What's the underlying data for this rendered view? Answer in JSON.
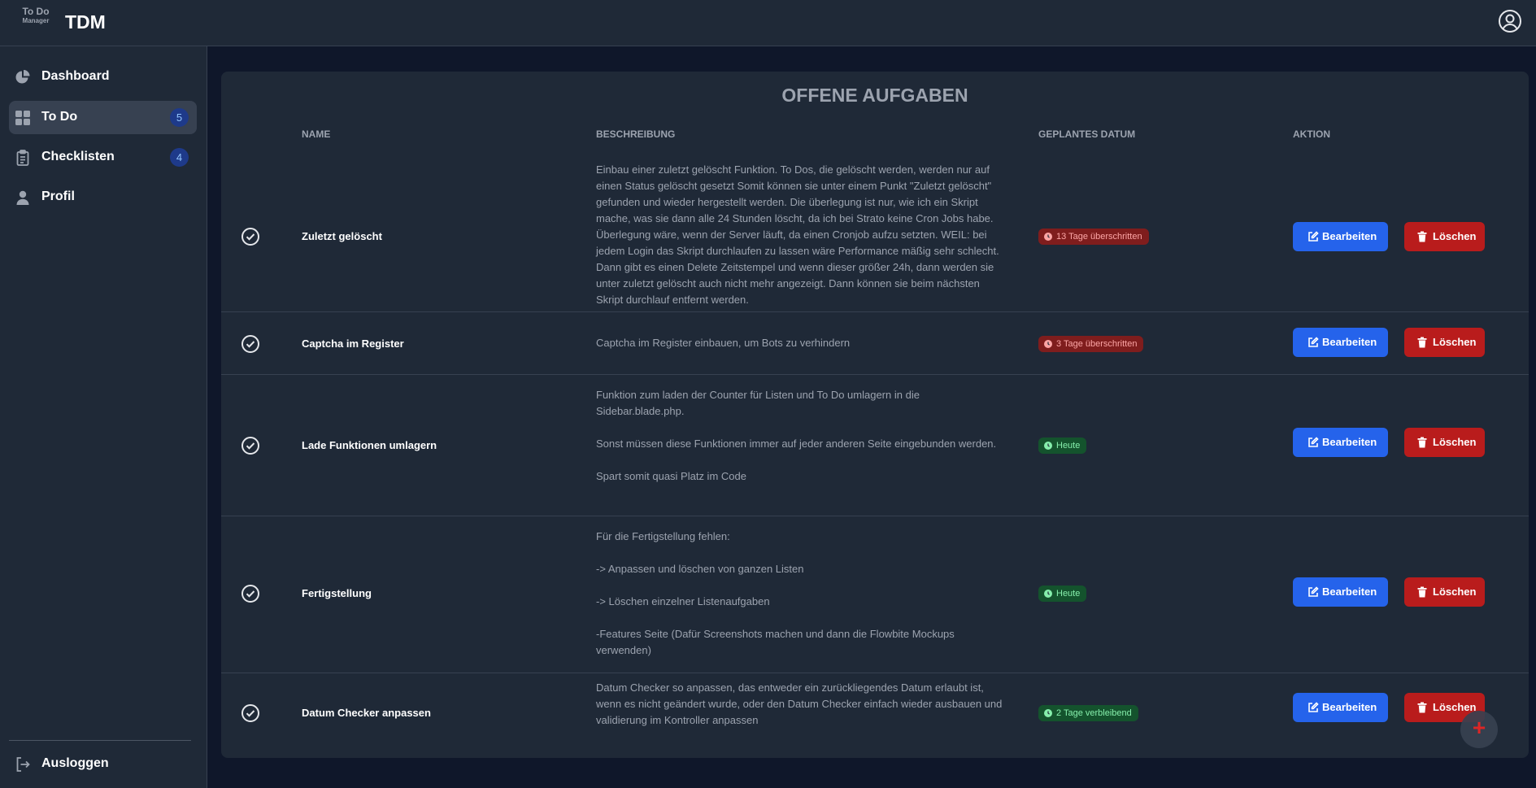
{
  "header": {
    "logo_line1": "To Do",
    "logo_line2": "Manager",
    "brand": "TDM",
    "user_icon": "user-circle-icon"
  },
  "sidebar": {
    "items": [
      {
        "label": "Dashboard",
        "icon": "pie-chart-icon"
      },
      {
        "label": "To Do",
        "icon": "grid-icon",
        "count": "5",
        "active": true
      },
      {
        "label": "Checklisten",
        "icon": "clipboard-icon",
        "count": "4"
      },
      {
        "label": "Profil",
        "icon": "user-icon"
      }
    ],
    "logout": {
      "label": "Ausloggen",
      "icon": "logout-icon"
    }
  },
  "main": {
    "title": "OFFENE AUFGABEN",
    "columns": [
      "Name",
      "Beschreibung",
      "Geplantes Datum",
      "Aktion"
    ],
    "edit_label": "Bearbeiten",
    "delete_label": "Löschen",
    "rows": [
      {
        "name": "Zuletzt gelöscht",
        "description": "Einbau einer zuletzt gelöscht Funktion. To Dos, die gelöscht werden, werden nur auf einen Status gelöscht gesetzt Somit können sie unter einem Punkt \"Zuletzt gelöscht\" gefunden und wieder hergestellt werden. Die überlegung ist nur, wie ich ein Skript mache, was sie dann alle 24 Stunden löscht, da ich bei Strato keine Cron Jobs habe. Überlegung wäre, wenn der Server läuft, da einen Cronjob aufzu setzten. WEIL: bei jedem Login das Skript durchlaufen zu lassen wäre Performance mäßig sehr schlecht. Dann gibt es einen Delete Zeitstempel und wenn dieser größer 24h, dann werden sie unter zuletzt gelöscht auch nicht mehr angezeigt. Dann können sie beim nächsten Skript durchlauf entfernt werden.",
        "date_badge": "13 Tage überschritten",
        "badge_status": "overdue"
      },
      {
        "name": "Captcha im Register",
        "description": "Captcha im Register einbauen, um Bots zu verhindern",
        "date_badge": "3 Tage überschritten",
        "badge_status": "overdue"
      },
      {
        "name": "Lade Funktionen umlagern",
        "description": "Funktion zum laden der Counter für Listen und To Do umlagern in die Sidebar.blade.php.\n\nSonst müssen diese Funktionen immer auf jeder anderen Seite eingebunden werden.\n\nSpart somit quasi Platz im Code",
        "date_badge": "Heute",
        "badge_status": "ok"
      },
      {
        "name": "Fertigstellung",
        "description": "Für die Fertigstellung fehlen:\n\n-> Anpassen und löschen von ganzen Listen\n\n-> Löschen einzelner Listenaufgaben\n\n-Features Seite (Dafür Screenshots machen und dann die Flowbite Mockups verwenden)",
        "date_badge": "Heute",
        "badge_status": "ok"
      },
      {
        "name": "Datum Checker anpassen",
        "description": "Datum Checker so anpassen, das entweder ein zurückliegendes Datum erlaubt ist, wenn es nicht geändert wurde, oder den Datum Checker einfach wieder ausbauen und validierung im Kontroller anpassen",
        "date_badge": "2 Tage verbleibend",
        "badge_status": "ok"
      }
    ]
  },
  "fab": {
    "symbol": "+",
    "icon": "plus-icon"
  },
  "colors": {
    "background": "#0f172a",
    "panel": "#1f2937",
    "primary": "#2563eb",
    "danger": "#b91c1c",
    "overdue_badge": "#7f1d1d",
    "ok_badge": "#14532d"
  }
}
